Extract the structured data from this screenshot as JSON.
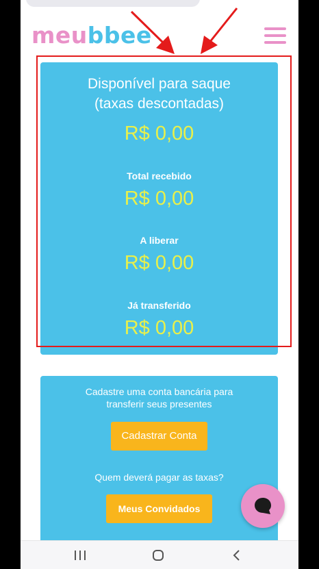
{
  "header": {
    "logo_part1": "meu",
    "logo_part2": "bbee",
    "menu_icon": "hamburger-menu-icon"
  },
  "balance_card": {
    "title_line1": "Disponível para saque",
    "title_line2": "(taxas descontadas)",
    "available_value": "R$ 0,00",
    "total_received_label": "Total recebido",
    "total_received_value": "R$ 0,00",
    "to_release_label": "A liberar",
    "to_release_value": "R$ 0,00",
    "transferred_label": "Já transferido",
    "transferred_value": "R$ 0,00"
  },
  "bank_card": {
    "prompt_line1": "Cadastre uma conta bancária para",
    "prompt_line2": "transferir seus presentes",
    "register_button": "Cadastrar Conta",
    "fees_question": "Quem deverá pagar as taxas?",
    "guests_button": "Meus Convidados"
  },
  "chat_button": {
    "icon": "chat-bubble-icon"
  },
  "navbar": {
    "icons": [
      "recent-apps-icon",
      "home-icon",
      "back-icon"
    ]
  },
  "colors": {
    "accent_blue": "#4bc1e8",
    "brand_pink": "#e991c8",
    "money_yellow": "#e9f04a",
    "button_orange": "#f9b51c",
    "highlight_red": "#e41b1b"
  }
}
